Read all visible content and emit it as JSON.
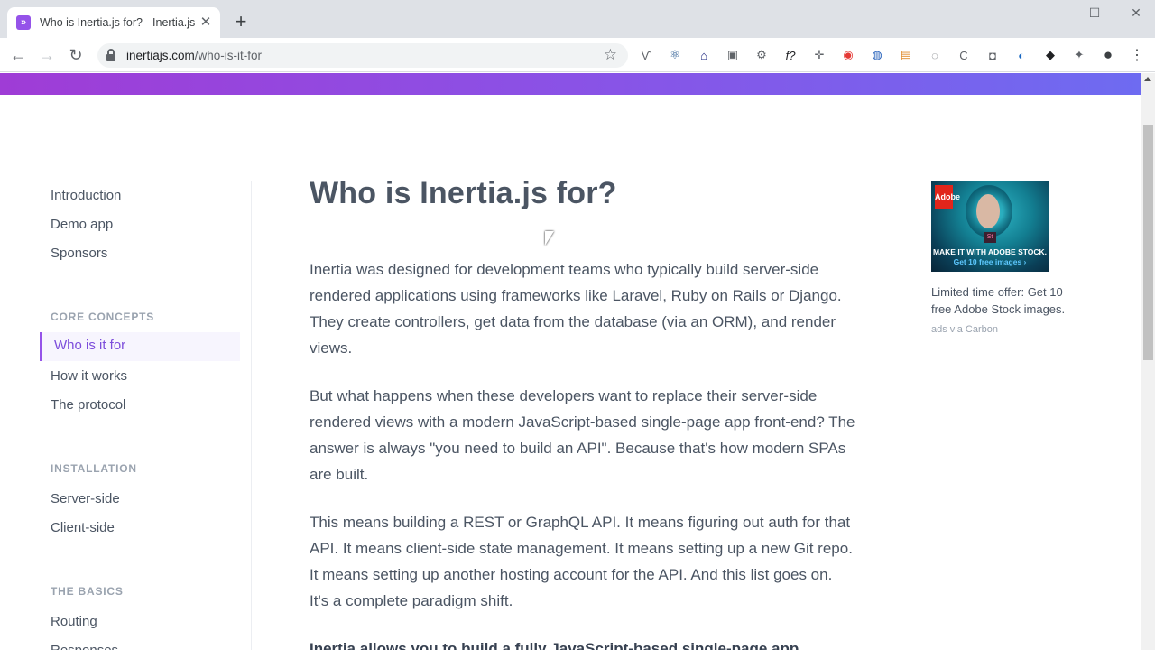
{
  "browser": {
    "tab": {
      "favicon": "»",
      "title": "Who is Inertia.js for? - Inertia.js",
      "close": "✕"
    },
    "new_tab": "+",
    "window_controls": {
      "minimize": "—",
      "maximize": "☐",
      "close": "✕"
    },
    "nav": {
      "back": "←",
      "forward": "→",
      "reload": "↻"
    },
    "url": {
      "host": "inertiajs.com",
      "path": "/who-is-it-for"
    },
    "star": "☆",
    "extensions": [
      "Ѵ",
      "⚛",
      "⌂",
      "▣",
      "⚙",
      "f?",
      "✛",
      "◉",
      "◍",
      "▤",
      "◌",
      "C",
      "◘",
      "◐",
      "◆",
      "✦",
      "●",
      "⋮"
    ]
  },
  "sidebar": {
    "top_links": [
      "Introduction",
      "Demo app",
      "Sponsors"
    ],
    "sections": [
      {
        "heading": "CORE CONCEPTS",
        "items": [
          "Who is it for",
          "How it works",
          "The protocol"
        ],
        "active": "Who is it for"
      },
      {
        "heading": "INSTALLATION",
        "items": [
          "Server-side",
          "Client-side"
        ]
      },
      {
        "heading": "THE BASICS",
        "items": [
          "Routing",
          "Responses"
        ]
      }
    ]
  },
  "content": {
    "title": "Who is Inertia.js for?",
    "paragraphs": [
      "Inertia was designed for development teams who typically build server-side rendered applications using frameworks like Laravel, Ruby on Rails or Django. They create controllers, get data from the database (via an ORM), and render views.",
      "But what happens when these developers want to replace their server-side rendered views with a modern JavaScript-based single-page app front-end? The answer is always \"you need to build an API\". Because that's how modern SPAs are built.",
      "This means building a REST or GraphQL API. It means figuring out auth for that API. It means client-side state management. It means setting up a new Git repo. It means setting up another hosting account for the API. And this list goes on. It's a complete paradigm shift.",
      "Inertia allows you to build a fully JavaScript-based single-page app"
    ]
  },
  "ad": {
    "logo": "Adobe",
    "badge": "St",
    "line1": "MAKE IT WITH ADOBE STOCK.",
    "line2": "Get 10 free images ›",
    "text": "Limited time offer: Get 10 free Adobe Stock images.",
    "via": "ads via Carbon"
  },
  "colors": {
    "brand": "#9553e9",
    "active_text": "#7c4ddb",
    "band_start": "#9f3cd6",
    "band_end": "#6e6bf1"
  }
}
